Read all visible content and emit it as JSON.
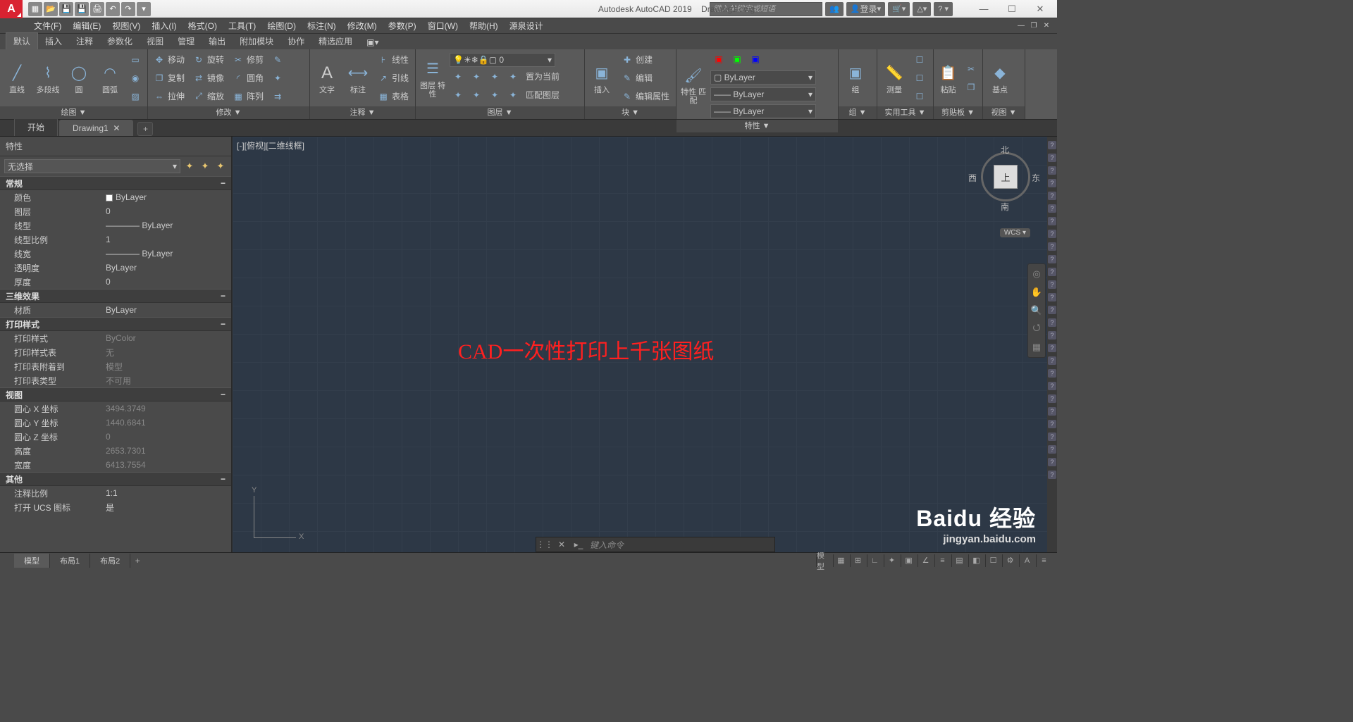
{
  "title": {
    "app": "Autodesk AutoCAD 2019",
    "file": "Drawing1.dwg"
  },
  "search_placeholder": "键入关键字或短语",
  "login": "登录",
  "menus": [
    "文件(F)",
    "编辑(E)",
    "视图(V)",
    "插入(I)",
    "格式(O)",
    "工具(T)",
    "绘图(D)",
    "标注(N)",
    "修改(M)",
    "参数(P)",
    "窗口(W)",
    "帮助(H)",
    "源泉设计"
  ],
  "ribbon_tabs": [
    "默认",
    "插入",
    "注释",
    "参数化",
    "视图",
    "管理",
    "输出",
    "附加模块",
    "协作",
    "精选应用"
  ],
  "active_ribbon_tab": "默认",
  "panels": {
    "draw": {
      "title": "绘图 ▼",
      "line": "直线",
      "polyline": "多段线",
      "circle": "圆",
      "arc": "圆弧"
    },
    "modify": {
      "title": "修改 ▼",
      "move": "移动",
      "copy": "复制",
      "stretch": "拉伸",
      "rotate": "旋转",
      "mirror": "镜像",
      "scale": "缩放",
      "trim": "修剪",
      "fillet": "圆角",
      "array": "阵列"
    },
    "annotate": {
      "title": "注释 ▼",
      "text": "文字",
      "dim": "标注",
      "linetype": "线性",
      "leader": "引线",
      "table": "表格"
    },
    "layers": {
      "title": "图层 ▼",
      "props": "图层\n特性",
      "current": "置为当前",
      "match": "匹配图层"
    },
    "block": {
      "title": "块 ▼",
      "insert": "插入",
      "create": "创建",
      "edit": "编辑",
      "editattr": "编辑属性"
    },
    "props": {
      "title": "特性 ▼",
      "match": "特性\n匹配",
      "bylayer": "ByLayer"
    },
    "group": {
      "title": "组 ▼",
      "group": "组"
    },
    "util": {
      "title": "实用工具 ▼",
      "measure": "测量"
    },
    "clip": {
      "title": "剪贴板 ▼",
      "paste": "粘贴"
    },
    "view": {
      "title": "视图 ▼",
      "base": "基点"
    }
  },
  "dtabs": {
    "start": "开始",
    "drawing": "Drawing1"
  },
  "props_panel": {
    "title": "特性",
    "selection": "无选择",
    "sections": {
      "general": "常规",
      "effects": "三维效果",
      "plot": "打印样式",
      "view": "视图",
      "other": "其他"
    },
    "rows": {
      "color_k": "颜色",
      "color_v": "ByLayer",
      "layer_k": "图层",
      "layer_v": "0",
      "ltype_k": "线型",
      "ltype_v": "ByLayer",
      "ltscale_k": "线型比例",
      "ltscale_v": "1",
      "lweight_k": "线宽",
      "lweight_v": "ByLayer",
      "transp_k": "透明度",
      "transp_v": "ByLayer",
      "thick_k": "厚度",
      "thick_v": "0",
      "mat_k": "材质",
      "mat_v": "ByLayer",
      "pstyle_k": "打印样式",
      "pstyle_v": "ByColor",
      "ptable_k": "打印样式表",
      "ptable_v": "无",
      "pattach_k": "打印表附着到",
      "pattach_v": "模型",
      "ptype_k": "打印表类型",
      "ptype_v": "不可用",
      "cx_k": "圆心 X 坐标",
      "cx_v": "3494.3749",
      "cy_k": "圆心 Y 坐标",
      "cy_v": "1440.6841",
      "cz_k": "圆心 Z 坐标",
      "cz_v": "0",
      "h_k": "高度",
      "h_v": "2653.7301",
      "w_k": "宽度",
      "w_v": "6413.7554",
      "ascale_k": "注释比例",
      "ascale_v": "1:1",
      "ucs_k": "打开 UCS 图标",
      "ucs_v": "是"
    }
  },
  "viewport_label": "[-][俯视][二维线框]",
  "canvas_text": "CAD一次性打印上千张图纸",
  "viewcube": {
    "top": "上",
    "n": "北",
    "s": "南",
    "e": "东",
    "w": "西",
    "wcs": "WCS ▾"
  },
  "axes": {
    "x": "X",
    "y": "Y"
  },
  "cmd_placeholder": "键入命令",
  "layout_tabs": {
    "model": "模型",
    "l1": "布局1",
    "l2": "布局2"
  },
  "status_model": "模型",
  "watermark": {
    "l1": "Baidu 经验",
    "l2": "jingyan.baidu.com"
  }
}
